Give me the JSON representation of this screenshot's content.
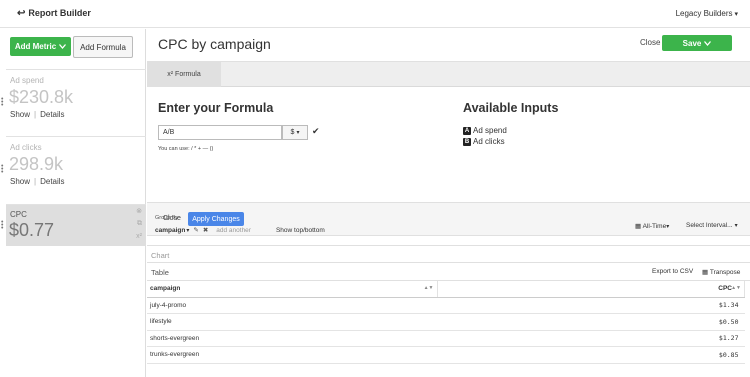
{
  "topbar": {
    "back_label": "Report Builder",
    "legacy_label": "Legacy Builders"
  },
  "sidebar": {
    "add_metric_label": "Add Metric",
    "add_formula_label": "Add Formula",
    "metrics": [
      {
        "name": "Ad spend",
        "value": "$230.8k",
        "show": "Show",
        "details": "Details"
      },
      {
        "name": "Ad clicks",
        "value": "298.9k",
        "show": "Show",
        "details": "Details"
      },
      {
        "name": "CPC",
        "value": "$0.77"
      }
    ]
  },
  "header": {
    "title": "CPC by campaign",
    "close_label": "Close",
    "save_label": "Save"
  },
  "formula": {
    "tab_label": "x² Formula",
    "enter_heading": "Enter your Formula",
    "input_value": "A/B",
    "unit": "$",
    "can_use": "You can use: / * + — ()",
    "available_heading": "Available Inputs",
    "inputs": [
      {
        "letter": "A",
        "name": "Ad spend"
      },
      {
        "letter": "B",
        "name": "Ad clicks"
      }
    ],
    "close_label": "Close",
    "apply_label": "Apply Changes"
  },
  "groupby": {
    "label": "Group By",
    "field": "campaign",
    "add_placeholder": "add another",
    "show_top_bottom": "Show top/bottom",
    "range": "All-Time",
    "interval": "Select Interval..."
  },
  "chart_label": "Chart",
  "table": {
    "label": "Table",
    "export_label": "Export to CSV",
    "transpose_label": "Transpose",
    "columns": [
      "campaign",
      "CPC"
    ],
    "rows": [
      [
        "july-4-promo",
        "$1.34"
      ],
      [
        "lifestyle",
        "$0.50"
      ],
      [
        "shorts-evergreen",
        "$1.27"
      ],
      [
        "trunks-evergreen",
        "$0.85"
      ]
    ]
  },
  "colors": {
    "green": "#3cb44b",
    "blue": "#4a86e8"
  }
}
